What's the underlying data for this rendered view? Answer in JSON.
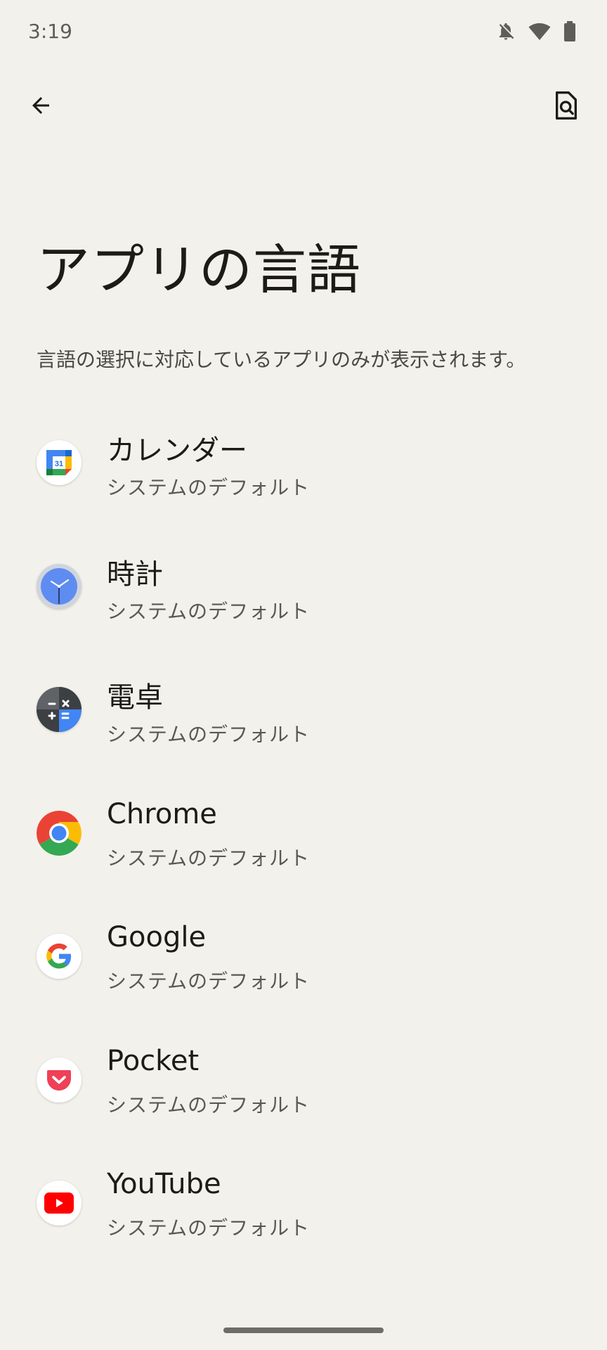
{
  "status_bar": {
    "time": "3:19",
    "icons": [
      "notifications-off-icon",
      "wifi-icon",
      "battery-icon"
    ]
  },
  "toolbar": {
    "back_icon": "arrow-back-icon",
    "search_icon": "search-document-icon"
  },
  "page": {
    "title": "アプリの言語",
    "subtitle": "言語の選択に対応しているアプリのみが表示されます。"
  },
  "apps": [
    {
      "name": "カレンダー",
      "language": "システムのデフォルト",
      "icon": "calendar-icon"
    },
    {
      "name": "時計",
      "language": "システムのデフォルト",
      "icon": "clock-icon"
    },
    {
      "name": "電卓",
      "language": "システムのデフォルト",
      "icon": "calculator-icon"
    },
    {
      "name": "Chrome",
      "language": "システムのデフォルト",
      "icon": "chrome-icon"
    },
    {
      "name": "Google",
      "language": "システムのデフォルト",
      "icon": "google-icon"
    },
    {
      "name": "Pocket",
      "language": "システムのデフォルト",
      "icon": "pocket-icon"
    },
    {
      "name": "YouTube",
      "language": "システムのデフォルト",
      "icon": "youtube-icon"
    }
  ],
  "calendar_icon_day": "31",
  "colors": {
    "background": "#f3f1ec",
    "google_blue": "#4285f4",
    "google_red": "#ea4335",
    "google_yellow": "#fbbc04",
    "google_green": "#34a853",
    "pocket_red": "#ef4056",
    "youtube_red": "#ff0000"
  }
}
